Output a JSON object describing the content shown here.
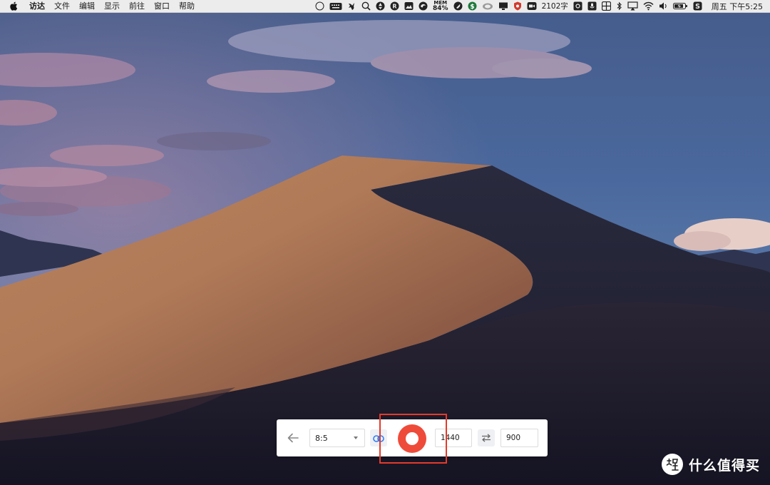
{
  "menubar": {
    "apple_icon": "apple-logo-icon",
    "items": [
      {
        "label": "访达",
        "bold": true
      },
      {
        "label": "文件"
      },
      {
        "label": "编辑"
      },
      {
        "label": "显示"
      },
      {
        "label": "前往"
      },
      {
        "label": "窗口"
      },
      {
        "label": "帮助"
      }
    ],
    "tray": {
      "mem_label": "MEM",
      "mem_value": "84%",
      "word_count": "2102字",
      "clock": "周五 下午5:25"
    }
  },
  "toolbar": {
    "back_icon": "arrow-left-icon",
    "ratio_value": "8:5",
    "link_icon": "link-icon",
    "record_icon": "record-icon",
    "width_value": "1440",
    "swap_icon": "swap-arrows-icon",
    "height_value": "900"
  },
  "highlight_color": "#e53a2a",
  "record_color": "#ef4b3a",
  "link_color": "#2f7cf6",
  "watermark": {
    "text": "什么值得买",
    "logo_icon": "smzdm-logo-icon"
  }
}
